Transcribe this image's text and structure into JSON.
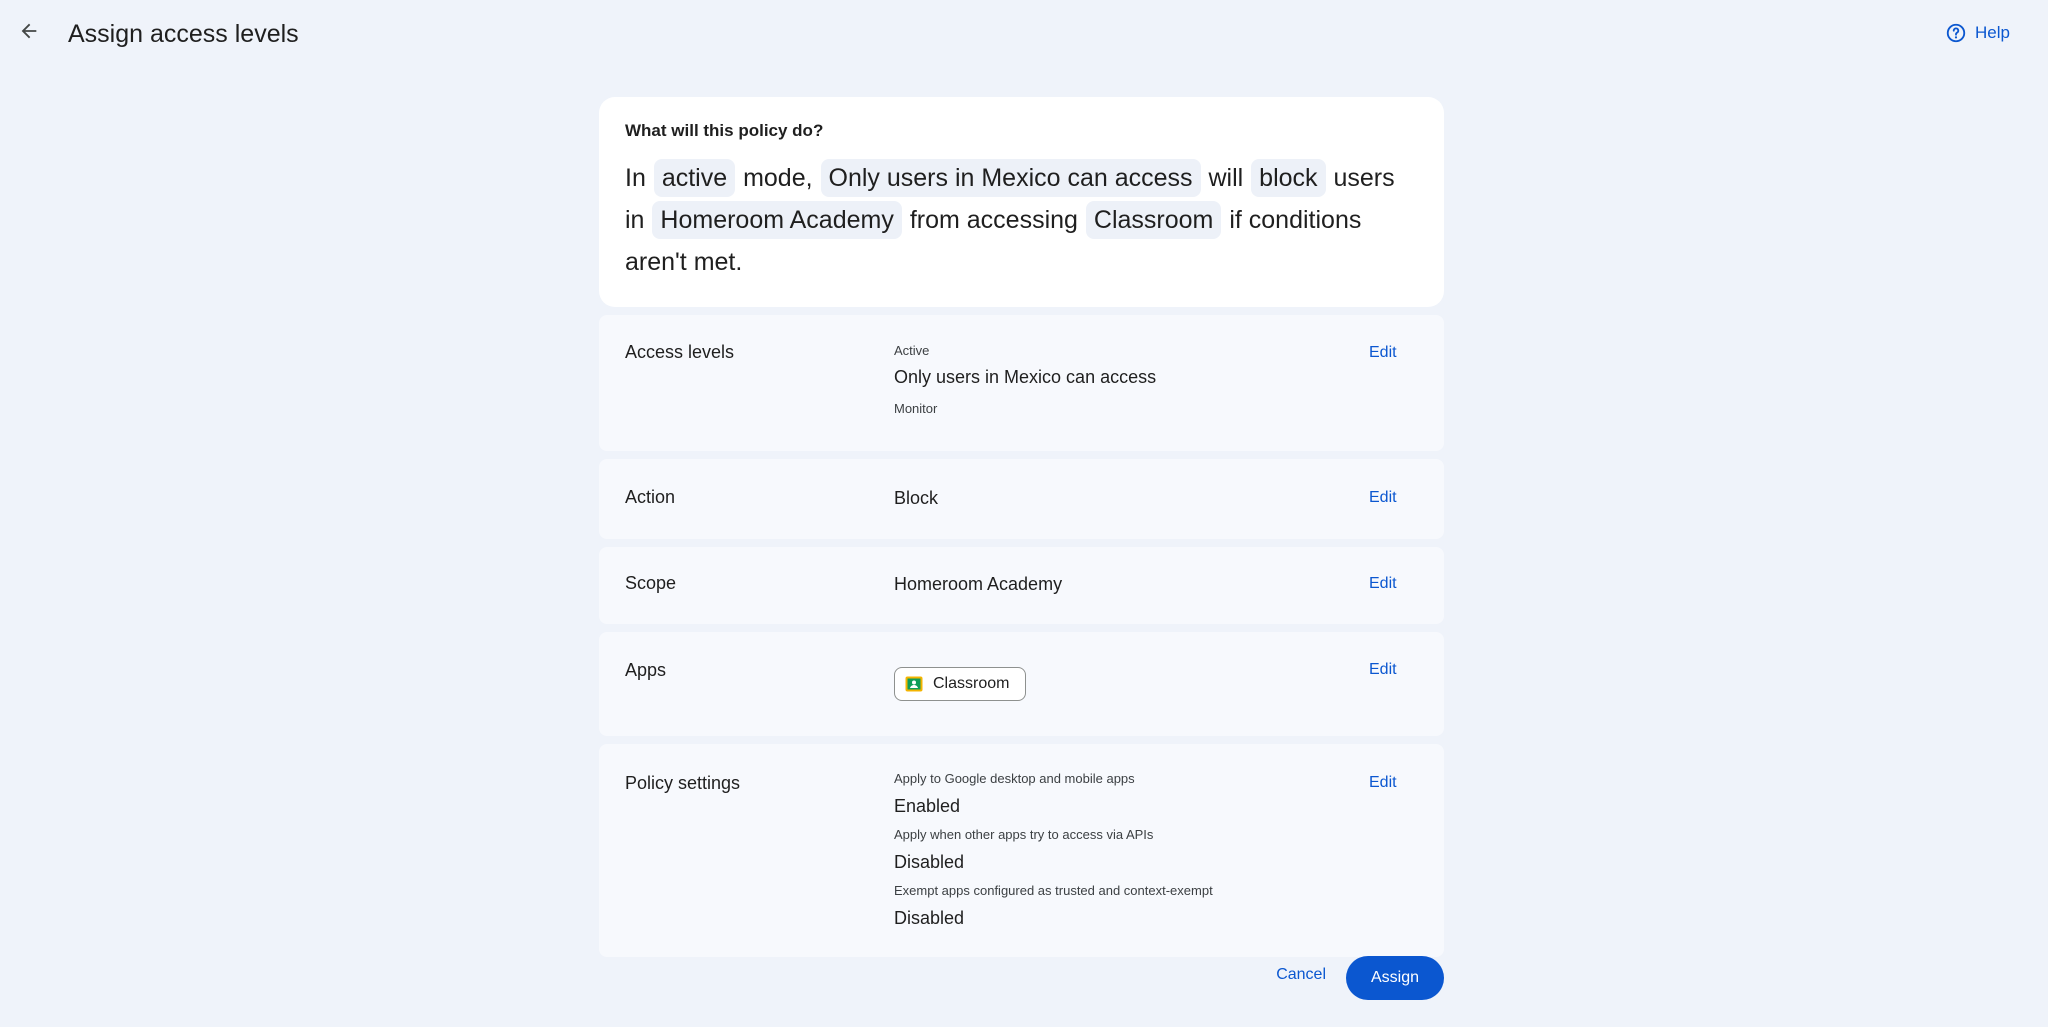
{
  "header": {
    "title": "Assign access levels",
    "help_label": "Help"
  },
  "summary": {
    "title": "What will this policy do?",
    "parts": {
      "t1": "In",
      "mode": "active",
      "t2": "mode,",
      "access_level": "Only users in Mexico can access",
      "t3": "will",
      "action": "block",
      "t4": "users in",
      "scope": "Homeroom Academy",
      "t5": "from accessing",
      "app": "Classroom",
      "t6": "if conditions aren't met."
    }
  },
  "sections": {
    "access_levels": {
      "label": "Access levels",
      "active_label": "Active",
      "active_value": "Only users in Mexico can access",
      "monitor_label": "Monitor",
      "edit": "Edit"
    },
    "action": {
      "label": "Action",
      "value": "Block",
      "edit": "Edit"
    },
    "scope": {
      "label": "Scope",
      "value": "Homeroom Academy",
      "edit": "Edit"
    },
    "apps": {
      "label": "Apps",
      "app_name": "Classroom",
      "edit": "Edit"
    },
    "policy_settings": {
      "label": "Policy settings",
      "edit": "Edit",
      "items": [
        {
          "label": "Apply to Google desktop and mobile apps",
          "value": "Enabled"
        },
        {
          "label": "Apply when other apps try to access via APIs",
          "value": "Disabled"
        },
        {
          "label": "Exempt apps configured as trusted and context-exempt",
          "value": "Disabled"
        }
      ]
    }
  },
  "footer": {
    "cancel_label": "Cancel",
    "assign_label": "Assign"
  },
  "colors": {
    "accent": "#0b57d0",
    "background": "#eff3fa",
    "card": "#ffffff",
    "section": "#f7f9fd"
  }
}
